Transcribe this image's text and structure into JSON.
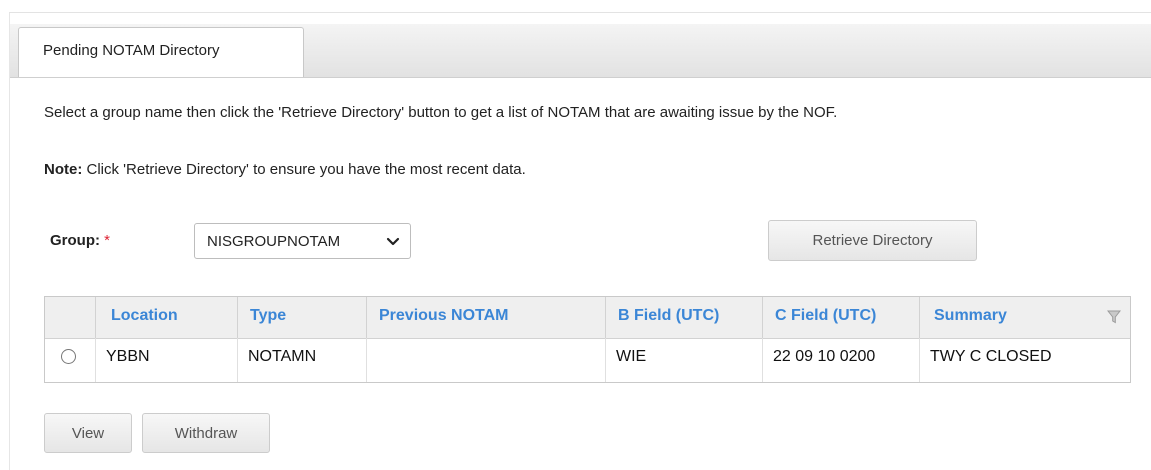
{
  "tab": {
    "label": "Pending NOTAM Directory"
  },
  "instructions": {
    "line1": "Select a group name then click the 'Retrieve Directory' button to get a list of NOTAM that are awaiting issue by the NOF.",
    "note_label": "Note:",
    "note_text": " Click 'Retrieve Directory' to ensure you have the most recent data."
  },
  "form": {
    "group_label": "Group:",
    "required_marker": "*",
    "group_value": "NISGROUPNOTAM",
    "retrieve_button": "Retrieve Directory"
  },
  "table": {
    "columns": [
      "Location",
      "Type",
      "Previous NOTAM",
      "B Field (UTC)",
      "C Field (UTC)",
      "Summary"
    ],
    "rows": [
      {
        "selected": false,
        "location": "YBBN",
        "type": "NOTAMN",
        "previous_notam": "",
        "b_field": "WIE",
        "c_field": "22 09 10 0200",
        "summary": "TWY C CLOSED"
      }
    ]
  },
  "actions": {
    "view": "View",
    "withdraw": "Withdraw"
  },
  "icons": {
    "dropdown": "chevron-down-icon",
    "filter": "filter-icon",
    "row_select": "radio-icon"
  },
  "colors": {
    "link_header": "#3b86d6",
    "required": "#d22233"
  }
}
